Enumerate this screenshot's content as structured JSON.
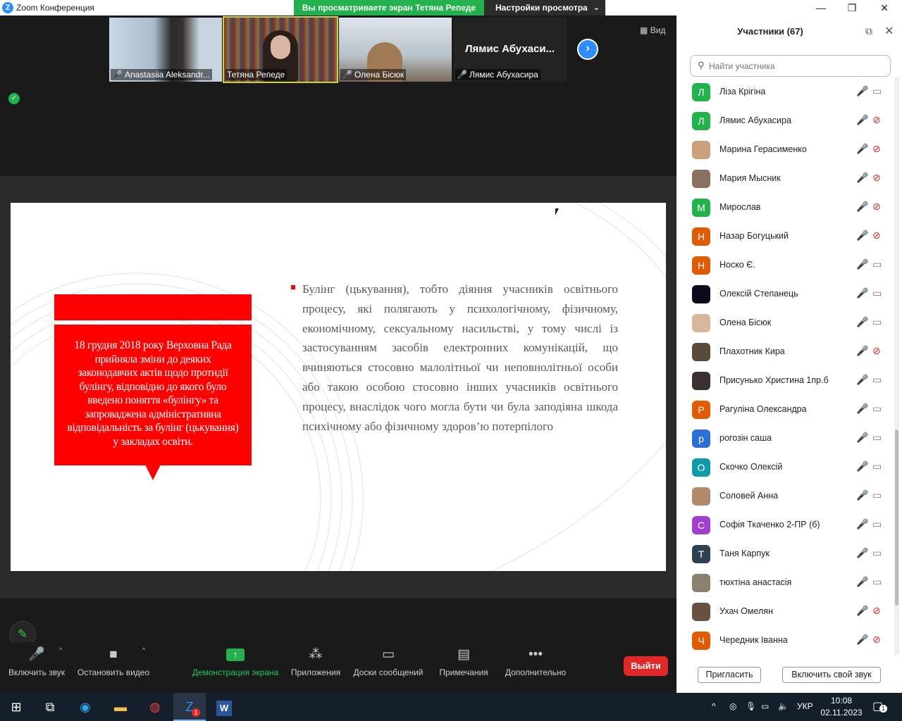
{
  "window": {
    "title": "Zoom Конференция",
    "share_banner": "Вы просматриваете экран Тетяна Репеде",
    "view_options": "Настройки просмотра"
  },
  "videos": [
    {
      "name": "Anastasiia Aleksandr..."
    },
    {
      "name": "Тетяна Репеде"
    },
    {
      "name": "Олена Бісюк"
    },
    {
      "name": "Лямис Абухасира",
      "big_name": "Лямис  Абухаси..."
    }
  ],
  "view_button": "Вид",
  "slide": {
    "red_box_text": "18 грудня 2018 року Верховна Рада прийняла зміни до деяких законодавчих актів щодо протидії булінгу, відповідно до якого було введено поняття «булінгу» та запроваджена адміністративна відповідальність за булінг (цькування) у закладах освіти.",
    "bullet_text": "Булінг (цькування), тобто діяння учасників освітнього процесу, які полягають у психологічному, фізичному, економічному, сексуальному насильстві, у тому числі із застосуванням засобів електронних комунікацій, що вчиняються стосовно малолітньої чи неповнолітньої особи або такою особою стосовно інших учасників освітнього процесу, внаслідок чого могла бути чи була заподіяна шкода психічному або фізичному здоров’ю потерпілого"
  },
  "toolbar": {
    "unmute": "Включить звук",
    "stop_video": "Остановить видео",
    "share_screen": "Демонстрация экрана",
    "apps": "Приложения",
    "whiteboards": "Доски сообщений",
    "notes": "Примечания",
    "more": "Дополнительно",
    "leave": "Выйти"
  },
  "participants": {
    "title": "Участники (67)",
    "search_placeholder": "Найти участника",
    "list": [
      {
        "name": "Ліза Крігіна",
        "initial": "Л",
        "color": "#22b14c",
        "cam_off": false
      },
      {
        "name": "Лямис Абухасира",
        "initial": "Л",
        "color": "#22b14c",
        "cam_off": true
      },
      {
        "name": "Марина Герасименко",
        "initial": "",
        "color": "#c9a07a",
        "cam_off": true
      },
      {
        "name": "Мария Мысник",
        "initial": "",
        "color": "#8a7060",
        "cam_off": true
      },
      {
        "name": "Мирослав",
        "initial": "М",
        "color": "#22b14c",
        "cam_off": true
      },
      {
        "name": "Назар Богуцький",
        "initial": "Н",
        "color": "#e05a00",
        "cam_off": true
      },
      {
        "name": "Носко Є.",
        "initial": "Н",
        "color": "#e05a00",
        "cam_off": false
      },
      {
        "name": "Олексій Степанець",
        "initial": "",
        "color": "#0a0a1e",
        "cam_off": false
      },
      {
        "name": "Олена Бісюк",
        "initial": "",
        "color": "#d8b89a",
        "cam_off": false
      },
      {
        "name": "Плахотник Кира",
        "initial": "",
        "color": "#5a4a3a",
        "cam_off": true
      },
      {
        "name": "Присунько Христина 1пр.б",
        "initial": "",
        "color": "#3a3030",
        "cam_off": false
      },
      {
        "name": "Рагуліна Олександра",
        "initial": "Р",
        "color": "#e05a00",
        "cam_off": false
      },
      {
        "name": "рогозін саша",
        "initial": "р",
        "color": "#2d6fd6",
        "cam_off": false
      },
      {
        "name": "Скочко Олексій",
        "initial": "О",
        "color": "#0e9aa7",
        "cam_off": false
      },
      {
        "name": "Соловей Анна",
        "initial": "",
        "color": "#b08a6a",
        "cam_off": false
      },
      {
        "name": "Софія Ткаченко 2-ПР (б)",
        "initial": "С",
        "color": "#a23fd0",
        "cam_off": false
      },
      {
        "name": "Таня Карпук",
        "initial": "Т",
        "color": "#2f4050",
        "cam_off": false
      },
      {
        "name": "тюхтіна анастасія",
        "initial": "",
        "color": "#8a8070",
        "cam_off": false
      },
      {
        "name": "Ухач Омелян",
        "initial": "",
        "color": "#6a5040",
        "cam_off": true
      },
      {
        "name": "Чередник Іванна",
        "initial": "Ч",
        "color": "#e05a00",
        "cam_off": true
      }
    ],
    "invite": "Пригласить",
    "unmute_self": "Включить свой звук"
  },
  "taskbar": {
    "language": "УКР",
    "time": "10:08",
    "date": "02.11.2023",
    "zoom_badge": "1",
    "notif_count": "1"
  }
}
